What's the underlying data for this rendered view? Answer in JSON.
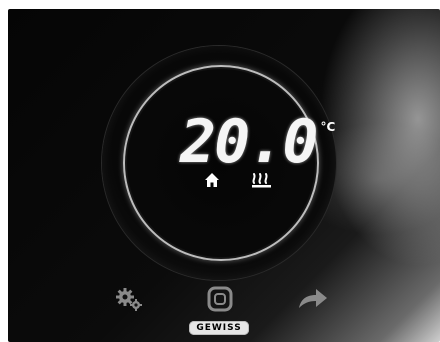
{
  "thermostat": {
    "temperature": "20.0",
    "unit": "°C",
    "mode_icons": [
      "home-icon",
      "heating-icon"
    ]
  },
  "buttons": {
    "settings": "gear-icon",
    "center": "rounded-square-button",
    "next": "arrow-right-icon"
  },
  "brand": {
    "logo_text": "GEWISS"
  },
  "colors": {
    "display": "#ffffff",
    "icons": "#8a8a8a",
    "panel": "#050505"
  }
}
